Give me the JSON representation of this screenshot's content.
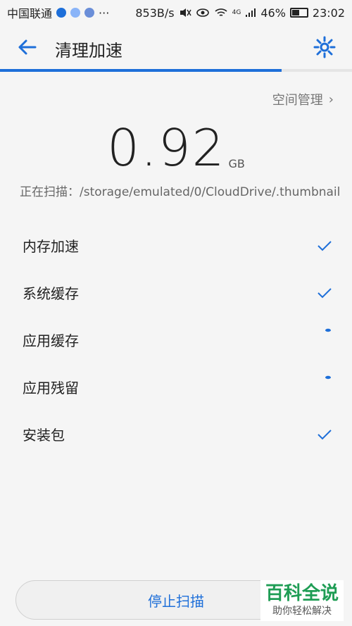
{
  "status": {
    "carrier": "中国联通",
    "speed": "853B/s",
    "signal": "4G",
    "battery": "46%",
    "time": "23:02"
  },
  "header": {
    "title": "清理加速"
  },
  "space_mgmt": {
    "label": "空间管理"
  },
  "summary": {
    "value": "0.92",
    "unit": "GB",
    "scanning": "正在扫描：/storage/emulated/0/CloudDrive/.thumbnail"
  },
  "items": [
    {
      "label": "内存加速",
      "state": "done"
    },
    {
      "label": "系统缓存",
      "state": "done"
    },
    {
      "label": "应用缓存",
      "state": "scanning"
    },
    {
      "label": "应用残留",
      "state": "scanning"
    },
    {
      "label": "安装包",
      "state": "done"
    }
  ],
  "actions": {
    "stop_label": "停止扫描"
  },
  "watermark": {
    "main": "百科全说",
    "sub": "助你轻松解决"
  },
  "colors": {
    "accent": "#1e6fd9"
  }
}
